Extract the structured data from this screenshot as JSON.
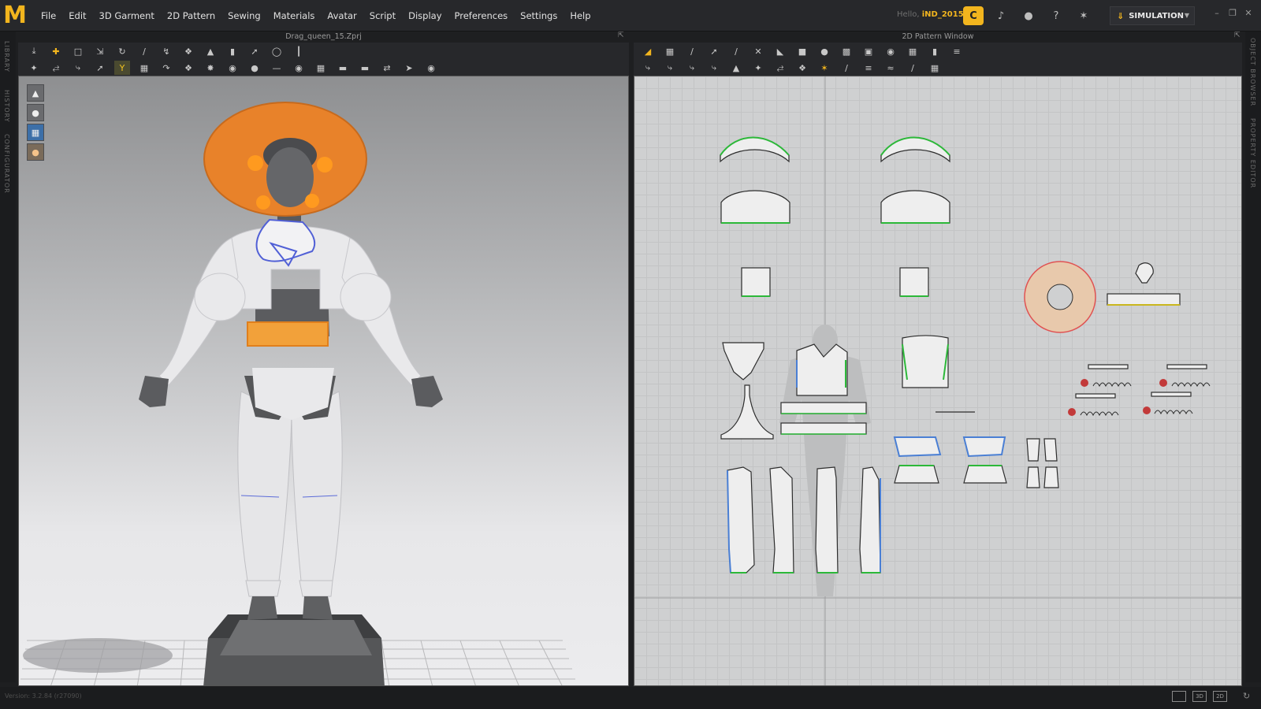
{
  "app": {
    "logo": "M"
  },
  "menu": [
    "File",
    "Edit",
    "3D Garment",
    "2D Pattern",
    "Sewing",
    "Materials",
    "Avatar",
    "Script",
    "Display",
    "Preferences",
    "Settings",
    "Help"
  ],
  "user": {
    "greeting": "Hello,",
    "name": "iND_2015"
  },
  "mode": {
    "label": "SIMULATION"
  },
  "side_tabs_left": [
    "LIBRARY",
    "HISTORY",
    "CONFIGURATOR"
  ],
  "side_tabs_right": [
    "OBJECT BROWSER",
    "PROPERTY EDITOR"
  ],
  "window3d": {
    "title": "Drag_queen_15.Zprj"
  },
  "window2d": {
    "title": "2D Pattern Window"
  },
  "viewport3d_tools": [
    "show-avatar-icon",
    "show-garment-icon",
    "fabric-view-icon",
    "avatar-view-icon"
  ],
  "toolbar3d_icons": {
    "row1": [
      "select-move-icon",
      "transform-icon",
      "box-select-icon",
      "scale-icon",
      "rotate-icon",
      "segment-icon",
      "fold-icon",
      "tack-icon",
      "pin-icon",
      "pin2-icon",
      "pointer-icon",
      "lasso-icon",
      "measure-icon"
    ],
    "row2": [
      "avatar-pose-icon",
      "drape-icon",
      "wrinkle-icon",
      "arrange-icon",
      "yellow-tool-icon",
      "garment-icon",
      "fit-icon",
      "shrink-icon",
      "fabric-icon",
      "button-icon",
      "buttonhole-icon",
      "line-icon",
      "stitch-icon",
      "measure-tape-icon",
      "zipper-icon",
      "fold-arrange-icon",
      "arrangement-point-icon",
      "shirt-icon",
      "sphere-icon"
    ]
  },
  "toolbar2d_icons": {
    "row1": [
      "edit-pattern-icon",
      "transform-pattern-icon",
      "edit-point-icon",
      "edit-curve-icon",
      "add-point-icon",
      "polygon-icon",
      "rectangle-icon",
      "ellipse-icon",
      "internal-polygon-icon",
      "internal-rectangle-icon",
      "internal-circle-icon",
      "dart-icon",
      "trace-icon",
      "pleat-icon",
      "shirring-icon"
    ],
    "row2": [
      "segment-sew-icon",
      "free-sew-icon",
      "check-sew-icon",
      "tack-on-2d-icon",
      "pin-2d-icon",
      "fold-2d-icon",
      "gather-icon",
      "elastic-icon",
      "topstitch-icon",
      "pipe-icon",
      "puckering-icon",
      "edit-stitch-icon",
      "topstitch-edit-icon",
      "trim-icon"
    ]
  },
  "status": {
    "version": "Version: 3.2.84",
    "build": "(r27090)"
  },
  "view_modes": [
    "",
    "3D",
    "2D"
  ],
  "colors": {
    "accent": "#f2b51e",
    "garment_orange": "#e8822a",
    "seam_green": "#2cb839",
    "selected_blue": "#4a7fd4",
    "pattern_fill": "#eeeeee"
  }
}
